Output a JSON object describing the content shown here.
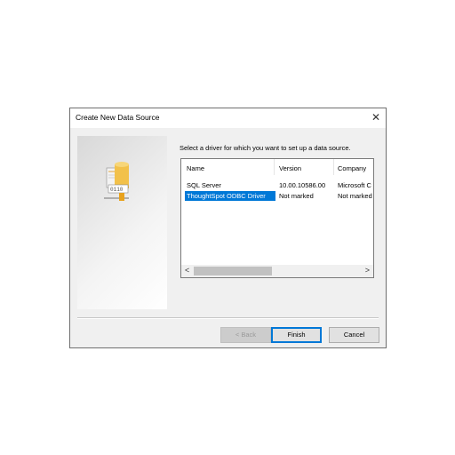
{
  "dialog": {
    "title": "Create New Data Source",
    "close_glyph": "✕",
    "instruction": "Select a driver for which you want to set up a data source."
  },
  "list": {
    "columns": [
      "Name",
      "Version",
      "Company"
    ],
    "rows": [
      {
        "name": "SQL Server",
        "version": "10.00.10586.00",
        "company": "Microsoft C"
      },
      {
        "name": "ThoughtSpot ODBC Driver",
        "version": "Not marked",
        "company": "Not marked",
        "selected": true
      }
    ],
    "scroll_left": "<",
    "scroll_right": ">"
  },
  "buttons": {
    "back": "< Back",
    "finish": "Finish",
    "cancel": "Cancel"
  },
  "icons": {
    "wizard_icon": "database-driver-icon"
  },
  "colors": {
    "selection": "#0078d7",
    "dialog_bg": "#f0f0f0"
  }
}
